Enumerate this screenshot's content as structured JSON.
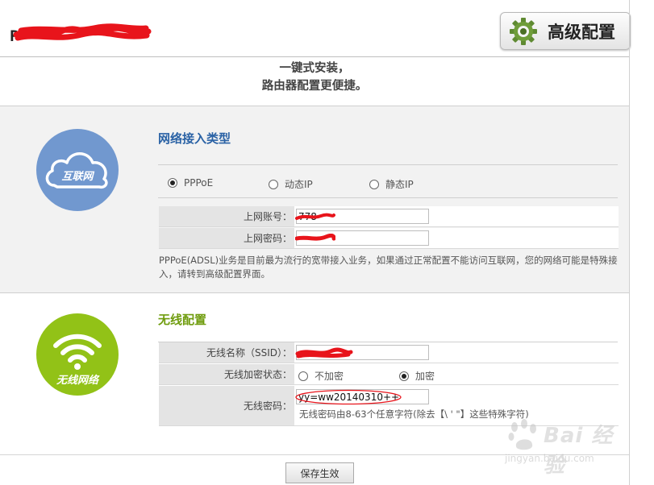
{
  "header": {
    "logo_text": "P",
    "advanced_button_label": "高级配置"
  },
  "slogan": {
    "line1": "一键式安装，",
    "line2": "路由器配置更便捷。"
  },
  "network": {
    "icon_caption": "互联网",
    "title": "网络接入类型",
    "connection_types": [
      {
        "label": "PPPoE",
        "selected": true
      },
      {
        "label": "动态IP",
        "selected": false
      },
      {
        "label": "静态IP",
        "selected": false
      }
    ],
    "account_label": "上网账号：",
    "account_value": "778",
    "password_label": "上网密码：",
    "description": "PPPoE(ADSL)业务是目前最为流行的宽带接入业务，如果通过正常配置不能访问互联网，您的网络可能是特殊接入，请转到高级配置界面。"
  },
  "wireless": {
    "icon_caption": "无线网络",
    "title": "无线配置",
    "ssid_label": "无线名称（SSID）：",
    "encryption_label": "无线加密状态：",
    "encryption_options": [
      {
        "label": "不加密",
        "selected": false
      },
      {
        "label": "加密",
        "selected": true
      }
    ],
    "password_label": "无线密码：",
    "password_value": "yy=ww20140310++",
    "password_hint": "无线密码由8-63个任意字符(除去【\\ ' \"】这些特殊字符)"
  },
  "footer": {
    "save_label": "保存生效"
  },
  "watermark": {
    "main": "Bai 经验",
    "sub": "jingyan.baidu.com"
  },
  "colors": {
    "network_title": "#2a62a5",
    "network_icon": "#7198cf",
    "wireless_title": "#6f9c0e",
    "wireless_icon": "#92c217",
    "scribble": "#e8141b"
  }
}
